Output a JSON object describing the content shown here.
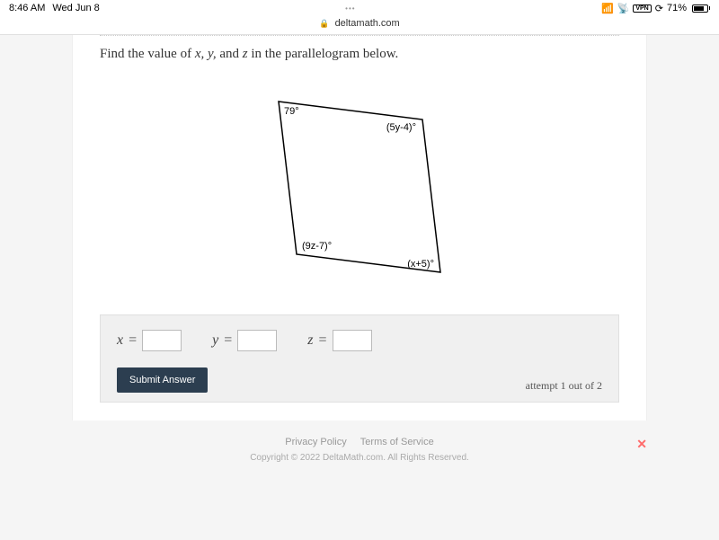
{
  "status": {
    "time": "8:46 AM",
    "date": "Wed Jun 8",
    "vpn": "VPN",
    "battery_pct": "71%",
    "orientation_lock": "⊘"
  },
  "browser": {
    "url": "deltamath.com"
  },
  "question": {
    "prompt_prefix": "Find the value of ",
    "vars": "x, y,",
    "vars_and": " and ",
    "vars_z": "z",
    "prompt_suffix": " in the parallelogram below."
  },
  "figure": {
    "top_left": "79°",
    "top_right": "(5y-4)°",
    "bottom_left": "(9z-7)°",
    "bottom_right": "(x+5)°"
  },
  "answers": {
    "x_label": "x",
    "y_label": "y",
    "z_label": "z",
    "equals": "=",
    "x_value": "",
    "y_value": "",
    "z_value": ""
  },
  "submit": {
    "button": "Submit Answer",
    "attempt": "attempt 1 out of 2"
  },
  "footer": {
    "privacy": "Privacy Policy",
    "terms": "Terms of Service",
    "copyright": "Copyright © 2022 DeltaMath.com. All Rights Reserved."
  }
}
